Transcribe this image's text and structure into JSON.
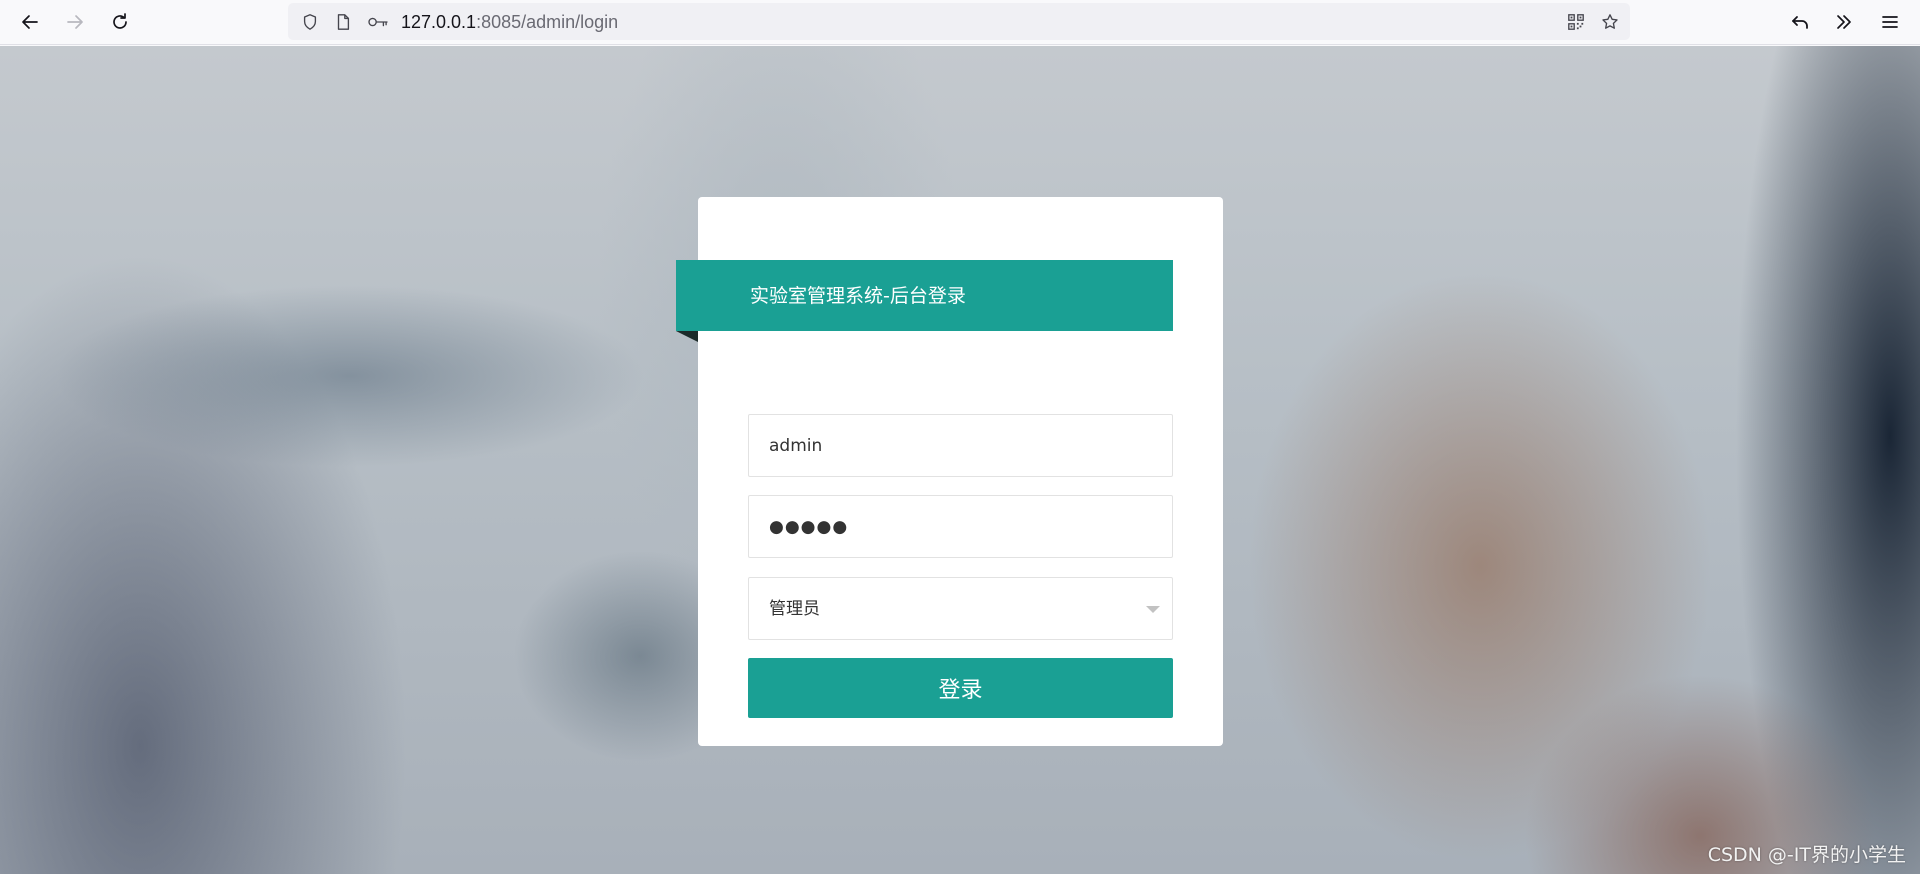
{
  "browser": {
    "url_host": "127.0.0.1",
    "url_rest": ":8085/admin/login",
    "icons": [
      "back-arrow-icon",
      "forward-arrow-icon",
      "reload-icon",
      "shield-icon",
      "page-icon",
      "key-icon",
      "qr-code-icon",
      "bookmark-star-icon",
      "undo-icon",
      "overflow-chevrons-icon",
      "menu-icon"
    ]
  },
  "login": {
    "title": "实验室管理系统-后台登录",
    "username_value": "admin",
    "password_value": "●●●●●",
    "role_selected": "管理员",
    "submit_label": "登录"
  },
  "colors": {
    "accent": "#1aa094",
    "card_bg": "#ffffff"
  },
  "watermark": "CSDN @-IT界的小学生"
}
